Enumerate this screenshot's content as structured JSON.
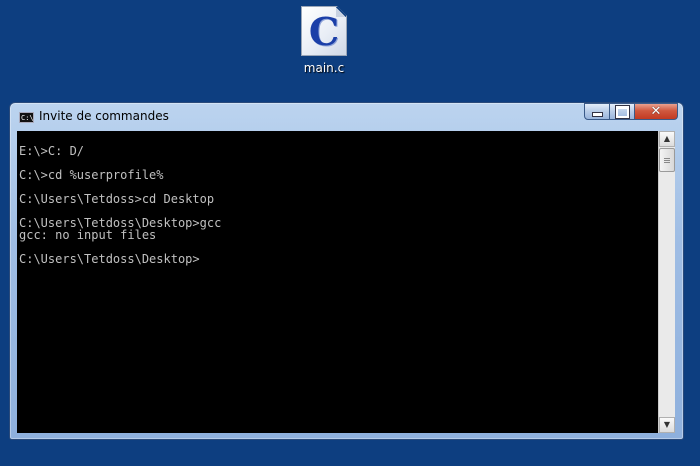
{
  "desktop": {
    "icon": {
      "letter": "C",
      "label": "main.c",
      "icon_name": "c-source-file-icon"
    }
  },
  "window": {
    "title": "Invite de commandes",
    "title_icon_text": "C:\\",
    "buttons": {
      "minimize": "minimize-icon",
      "maximize": "maximize-icon",
      "close": "close-icon"
    }
  },
  "console": {
    "lines": [
      "E:\\>C: D/",
      "",
      "C:\\>cd %userprofile%",
      "",
      "C:\\Users\\Tetdoss>cd Desktop",
      "",
      "C:\\Users\\Tetdoss\\Desktop>gcc",
      "gcc: no input files",
      "",
      "C:\\Users\\Tetdoss\\Desktop>"
    ]
  },
  "scrollbar": {
    "up": "▲",
    "down": "▼"
  },
  "colors": {
    "desktop": "#0d3e80",
    "console_bg": "#000000",
    "console_fg": "#c0c0c0",
    "close_button": "#c23a22"
  }
}
